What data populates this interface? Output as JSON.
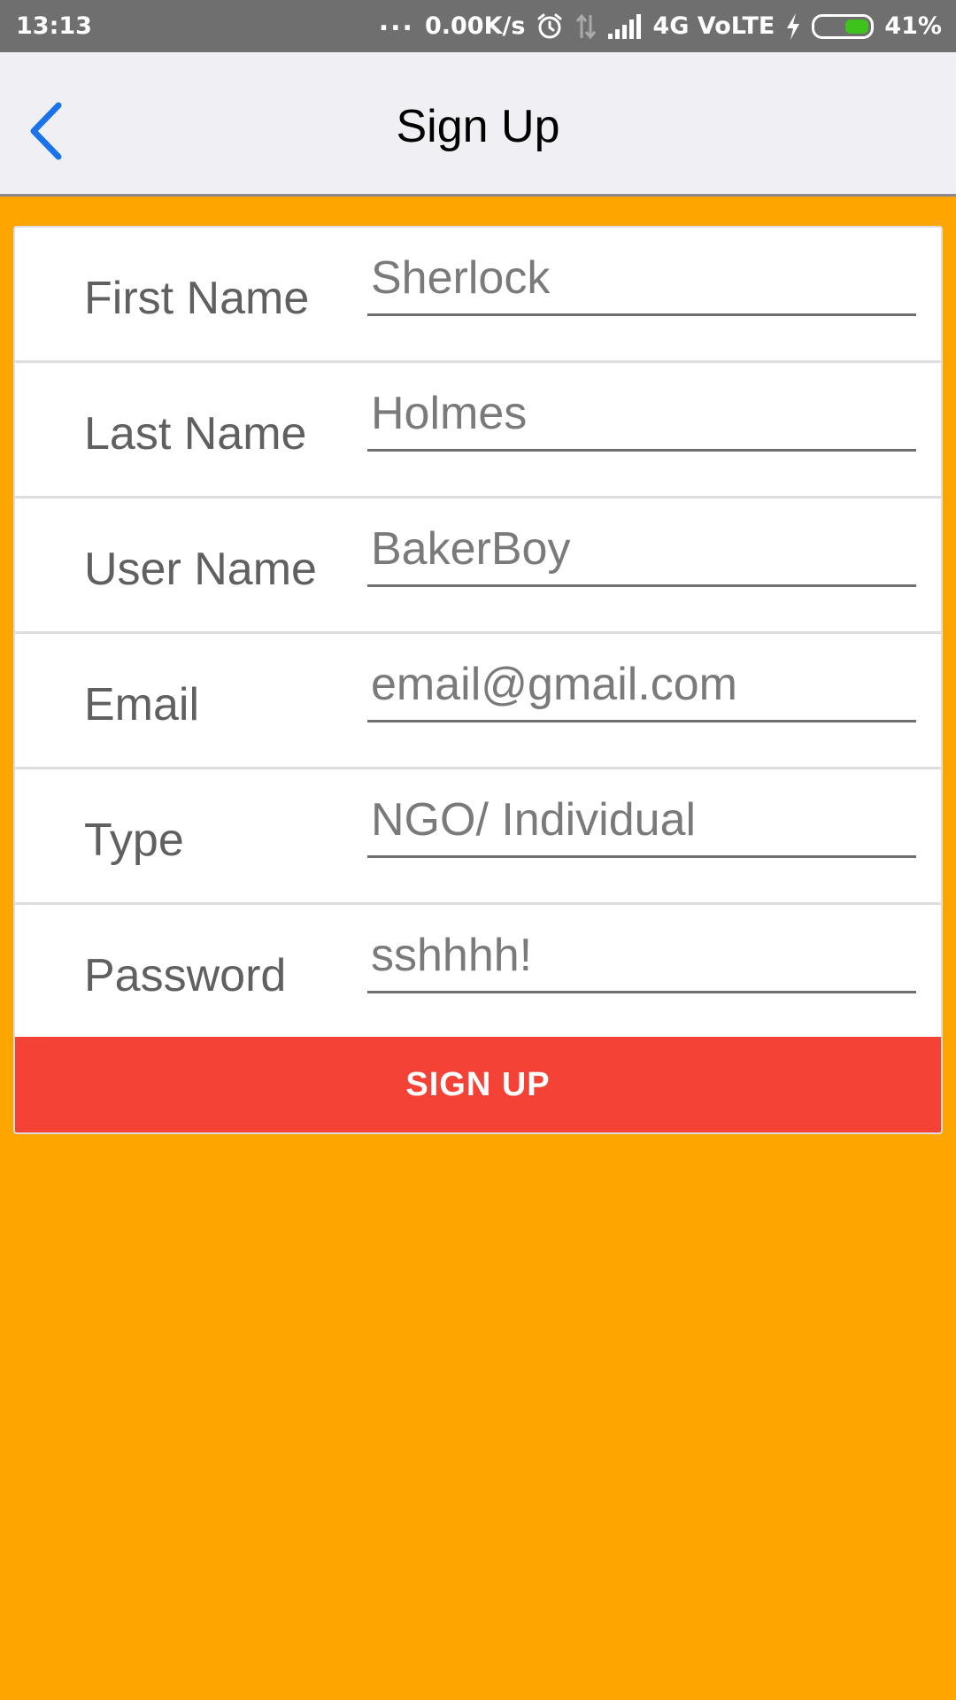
{
  "status_bar": {
    "time": "13:13",
    "dots": "...",
    "network_speed": "0.00K/s",
    "network_type": "4G VoLTE",
    "battery_percent": "41%",
    "battery_level": 0.41,
    "icons": [
      "alarm-icon",
      "data-arrows-icon",
      "signal-icon",
      "charging-icon",
      "battery-icon"
    ]
  },
  "nav": {
    "title": "Sign Up",
    "back_icon": "chevron-left-icon",
    "accent_color": "#1a73e8"
  },
  "form": {
    "fields": [
      {
        "label": "First Name",
        "value": "Sherlock"
      },
      {
        "label": "Last Name",
        "value": "Holmes"
      },
      {
        "label": "User Name",
        "value": "BakerBoy"
      },
      {
        "label": "Email",
        "value": "email@gmail.com"
      },
      {
        "label": "Type",
        "value": "NGO/ Individual"
      },
      {
        "label": "Password",
        "value": "sshhhh!"
      }
    ],
    "submit_label": "SIGN UP"
  },
  "colors": {
    "background": "#FFA500",
    "button": "#f44336",
    "nav_background": "#efeff4"
  }
}
